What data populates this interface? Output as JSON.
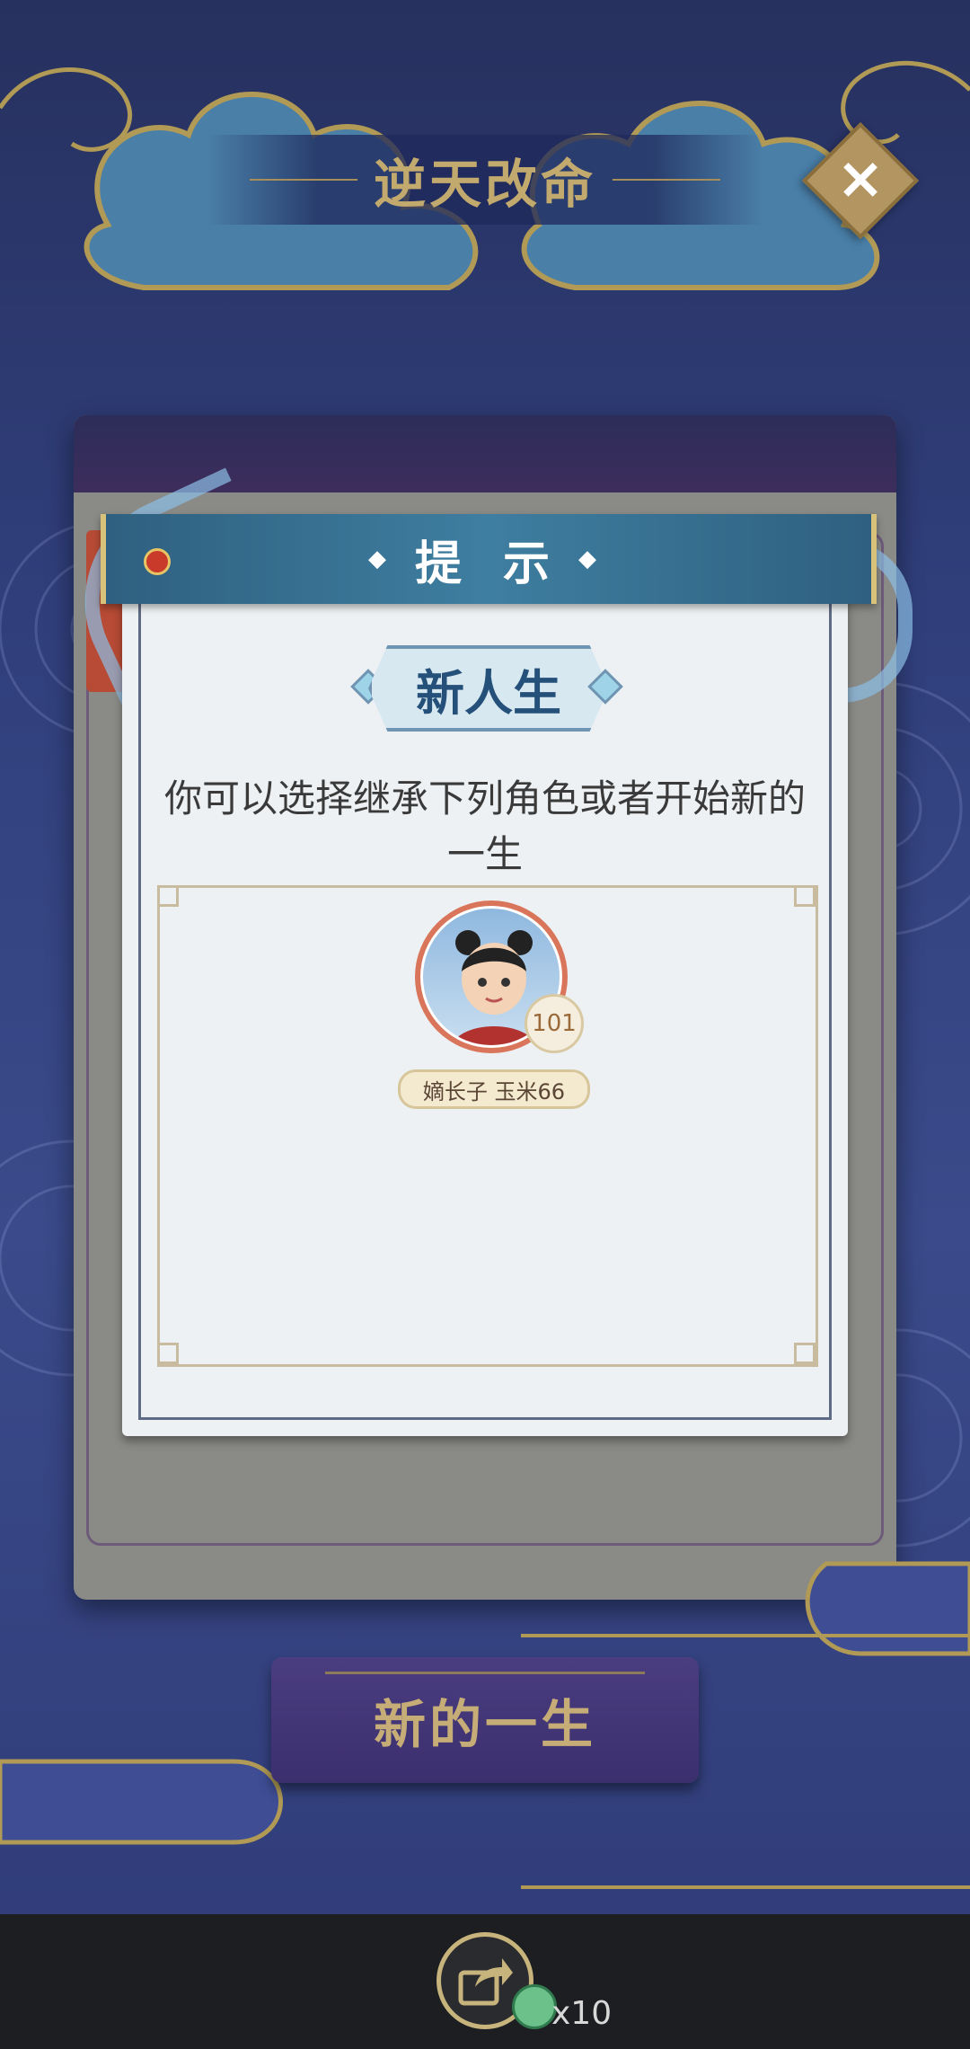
{
  "header": {
    "title": "逆天改命",
    "close_icon": "close-x-icon"
  },
  "dialog": {
    "banner_title": "提 示",
    "banner_dot": "◆",
    "subtitle": "新人生",
    "description": "你可以选择继承下列角色或者开始新的一生",
    "character": {
      "name": "嫡长子 玉米66",
      "level": "101",
      "avatar_icon": "child-avatar-icon"
    }
  },
  "action": {
    "new_life_label": "新的一生"
  },
  "footer": {
    "share_icon": "share-icon",
    "reward_count": "x10",
    "reward_icon": "jade-coin-icon"
  },
  "colors": {
    "gold": "#c2a96e",
    "banner": "#3e7ea0",
    "card": "#eef1f3",
    "bg": "#303f7c"
  }
}
